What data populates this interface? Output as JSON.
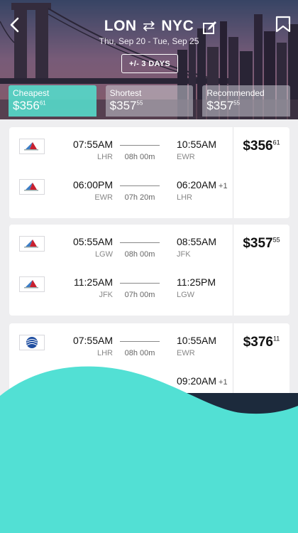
{
  "header": {
    "route_from": "LON",
    "route_to": "NYC",
    "swap_symbol": "⇄",
    "dates": "Thu, Sep 20 - Tue, Sep 25",
    "flex_label": "+/- 3 DAYS",
    "icons": {
      "back": "chevron-left-icon",
      "edit": "edit-icon",
      "bookmark": "bookmark-icon"
    }
  },
  "tabs": [
    {
      "label": "Cheapest",
      "price_main": "$356",
      "price_cents": "61",
      "active": true
    },
    {
      "label": "Shortest",
      "price_main": "$357",
      "price_cents": "55",
      "active": false
    },
    {
      "label": "Recommended",
      "price_main": "$357",
      "price_cents": "55",
      "active": false
    }
  ],
  "results": [
    {
      "price_main": "$356",
      "price_cents": "61",
      "legs": [
        {
          "airline_logo": "american-airlines-logo",
          "dep_time": "07:55AM",
          "dep_code": "LHR",
          "duration": "08h 00m",
          "arr_time": "10:55AM",
          "arr_code": "EWR",
          "plus_day": ""
        },
        {
          "airline_logo": "american-airlines-logo",
          "dep_time": "06:00PM",
          "dep_code": "EWR",
          "duration": "07h 20m",
          "arr_time": "06:20AM",
          "arr_code": "LHR",
          "plus_day": "+1"
        }
      ]
    },
    {
      "price_main": "$357",
      "price_cents": "55",
      "legs": [
        {
          "airline_logo": "american-airlines-logo",
          "dep_time": "05:55AM",
          "dep_code": "LGW",
          "duration": "08h 00m",
          "arr_time": "08:55AM",
          "arr_code": "JFK",
          "plus_day": ""
        },
        {
          "airline_logo": "american-airlines-logo",
          "dep_time": "11:25AM",
          "dep_code": "JFK",
          "duration": "07h 00m",
          "arr_time": "11:25PM",
          "arr_code": "LGW",
          "plus_day": ""
        }
      ]
    },
    {
      "price_main": "$376",
      "price_cents": "11",
      "legs": [
        {
          "airline_logo": "united-airlines-logo",
          "dep_time": "07:55AM",
          "dep_code": "LHR",
          "duration": "08h 00m",
          "arr_time": "10:55AM",
          "arr_code": "EWR",
          "plus_day": ""
        },
        {
          "airline_logo": "united-airlines-logo",
          "dep_time": "",
          "dep_code": "",
          "duration": "",
          "arr_time": "09:20AM",
          "arr_code": "",
          "plus_day": "+1"
        }
      ]
    }
  ],
  "colors": {
    "accent": "#56d7c8",
    "wave_teal": "#52e0d4",
    "wave_dark": "#1c2a3c",
    "aa_red": "#c8202f",
    "aa_blue": "#3b7cc4",
    "united_blue": "#1f4ea0"
  }
}
